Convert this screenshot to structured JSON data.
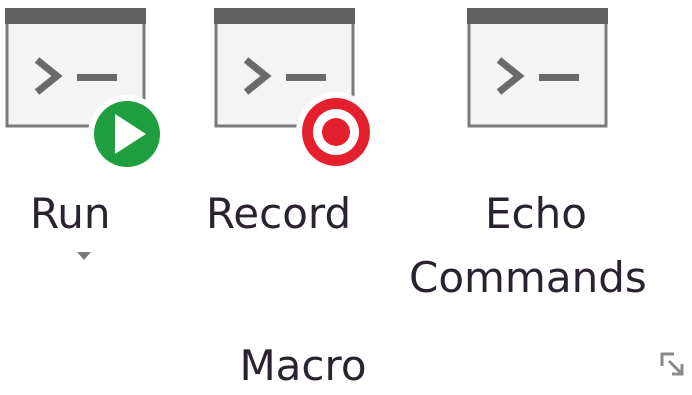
{
  "ribbon": {
    "group_label": "Macro",
    "buttons": [
      {
        "label": "Run",
        "icon": "console-run-icon",
        "has_dropdown": true
      },
      {
        "label": "Record",
        "icon": "console-record-icon",
        "has_dropdown": false
      },
      {
        "label_line1": "Echo",
        "label_line2": "Commands",
        "icon": "console-icon",
        "has_dropdown": false
      }
    ],
    "dialog_launcher_icon": "dialog-launcher-icon"
  },
  "colors": {
    "run_badge": "#1e9e3e",
    "record_badge": "#e5202e",
    "window_title": "#616161",
    "window_body": "#f4f4f4",
    "text": "#2b2230"
  }
}
